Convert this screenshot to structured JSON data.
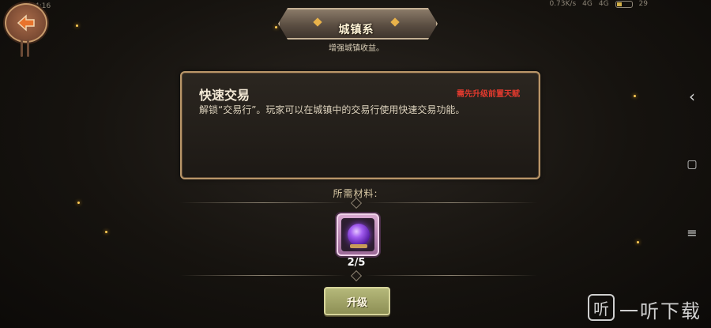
{
  "status_bar": {
    "time": "下午4:16",
    "speed": "0.73K/s",
    "signal_labels": [
      "4G",
      "4G"
    ],
    "battery": "29"
  },
  "header": {
    "title": "城镇系",
    "subtitle": "增强城镇收益。"
  },
  "card": {
    "title": "快速交易",
    "warning": "需先升级前置天赋",
    "description": "解锁“交易行”。玩家可以在城镇中的交易行使用快速交易功能。"
  },
  "materials": {
    "label": "所需材料:",
    "item_icon": "purple-orb-icon",
    "count": "2/5"
  },
  "actions": {
    "upgrade_label": "升级"
  },
  "system_nav": {
    "back_glyph": "‹",
    "home_glyph": "▢",
    "menu_glyph": "≡"
  },
  "watermark": {
    "icon_text": "听",
    "text": "一听下载"
  },
  "colors": {
    "warning": "#e23a2e",
    "card_border": "#b99669",
    "button": "#a5a86b",
    "orb": "#a35df0"
  }
}
